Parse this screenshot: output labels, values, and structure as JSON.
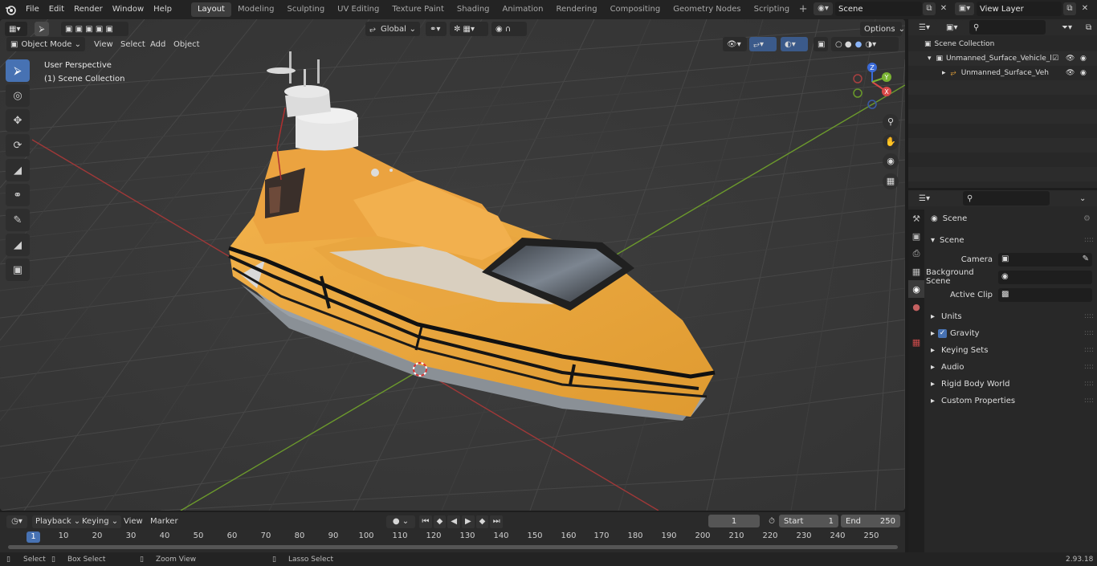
{
  "menu": [
    "File",
    "Edit",
    "Render",
    "Window",
    "Help"
  ],
  "workspaces": [
    "Layout",
    "Modeling",
    "Sculpting",
    "UV Editing",
    "Texture Paint",
    "Shading",
    "Animation",
    "Rendering",
    "Compositing",
    "Geometry Nodes",
    "Scripting"
  ],
  "active_workspace": "Layout",
  "scene_name": "Scene",
  "view_layer": "View Layer",
  "viewport": {
    "mode": "Object Mode",
    "menus": [
      "View",
      "Select",
      "Add",
      "Object"
    ],
    "transform_orientation": "Global",
    "options_label": "Options",
    "overlay_line1": "User Perspective",
    "overlay_line2": "(1) Scene Collection",
    "axes": {
      "x": "X",
      "y": "Y",
      "z": "Z"
    }
  },
  "timeline": {
    "menus": [
      "Playback",
      "Keying",
      "View",
      "Marker"
    ],
    "current_frame": "1",
    "start_label": "Start",
    "start_value": "1",
    "end_label": "End",
    "end_value": "250",
    "ruler": [
      "10",
      "20",
      "30",
      "40",
      "50",
      "60",
      "70",
      "80",
      "90",
      "100",
      "110",
      "120",
      "130",
      "140",
      "150",
      "160",
      "170",
      "180",
      "190",
      "200",
      "210",
      "220",
      "230",
      "240",
      "250"
    ],
    "playhead_label": "1"
  },
  "status": {
    "select": "Select",
    "box_select": "Box Select",
    "zoom_view": "Zoom View",
    "lasso_select": "Lasso Select",
    "version": "2.93.18"
  },
  "outliner": {
    "root": "Scene Collection",
    "items": [
      {
        "label": "Unmanned_Surface_Vehicle_l"
      },
      {
        "label": "Unmanned_Surface_Veh"
      }
    ]
  },
  "properties": {
    "context": "Scene",
    "panel_title": "Scene",
    "fields": [
      {
        "label": "Camera"
      },
      {
        "label": "Background Scene"
      },
      {
        "label": "Active Clip"
      }
    ],
    "subpanels": [
      "Units",
      "Gravity",
      "Keying Sets",
      "Audio",
      "Rigid Body World",
      "Custom Properties"
    ],
    "gravity_checked": true
  },
  "colors": {
    "accent": "#4772b3",
    "boat_body": "#e8a43a",
    "axis_x": "#cc3a3a",
    "axis_y": "#7ab332"
  }
}
